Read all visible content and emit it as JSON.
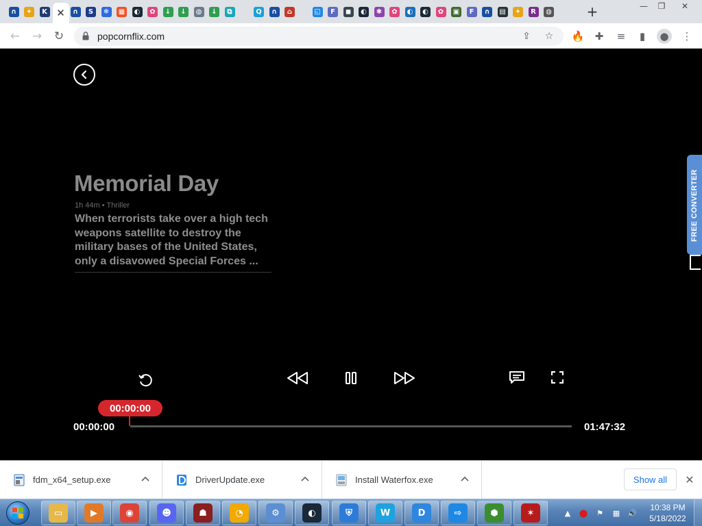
{
  "browser": {
    "tabs": [
      {
        "icon": "n-icon",
        "color": "#1a4fa0",
        "glyph": "∩"
      },
      {
        "icon": "fox-icon",
        "color": "#e8a317",
        "glyph": "✦"
      },
      {
        "icon": "k-icon",
        "color": "#1f3b73",
        "glyph": "K"
      },
      {
        "icon": "close-icon",
        "color": "#ffffff",
        "glyph": "✕",
        "active": true
      },
      {
        "icon": "n-icon",
        "color": "#1a4fa0",
        "glyph": "∩"
      },
      {
        "icon": "s-icon",
        "color": "#1e3a8a",
        "glyph": "S"
      },
      {
        "icon": "snowflake-icon",
        "color": "#2d6cdf",
        "glyph": "❄"
      },
      {
        "icon": "windows-icon",
        "color": "#f25022",
        "glyph": "▦"
      },
      {
        "icon": "steam-icon",
        "color": "#1b2838",
        "glyph": "◐"
      },
      {
        "icon": "pinwheel-icon",
        "color": "#e0457b",
        "glyph": "✿"
      },
      {
        "icon": "download-icon",
        "color": "#2e9e4f",
        "glyph": "↓"
      },
      {
        "icon": "download-icon",
        "color": "#2e9e4f",
        "glyph": "↓"
      },
      {
        "icon": "globe-icon",
        "color": "#6b7b8c",
        "glyph": "◍"
      },
      {
        "icon": "download-icon",
        "color": "#2e9e4f",
        "glyph": "↓"
      },
      {
        "icon": "copy-icon",
        "color": "#1aa6b7",
        "glyph": "⧉"
      },
      {
        "icon": "iq-icon",
        "color": "#1aa0d8",
        "glyph": "Q"
      },
      {
        "icon": "n-icon",
        "color": "#1a4fa0",
        "glyph": "∩"
      },
      {
        "icon": "house-icon",
        "color": "#c0392b",
        "glyph": "⌂"
      },
      {
        "icon": "frame-icon",
        "color": "#1e88e5",
        "glyph": "◱"
      },
      {
        "icon": "f-icon",
        "color": "#5c6bc0",
        "glyph": "F"
      },
      {
        "icon": "photo-icon",
        "color": "#37474f",
        "glyph": "◼"
      },
      {
        "icon": "steam-icon",
        "color": "#1b2838",
        "glyph": "◐"
      },
      {
        "icon": "puzzle-color-icon",
        "color": "#8e44ad",
        "glyph": "✱"
      },
      {
        "icon": "pinwheel-icon",
        "color": "#e0457b",
        "glyph": "✿"
      },
      {
        "icon": "steam-icon",
        "color": "#1b6fb8",
        "glyph": "◐"
      },
      {
        "icon": "steam-icon",
        "color": "#1b2838",
        "glyph": "◐"
      },
      {
        "icon": "pinwheel-icon",
        "color": "#e0457b",
        "glyph": "✿"
      },
      {
        "icon": "cube-icon",
        "color": "#3e6b2f",
        "glyph": "▣"
      },
      {
        "icon": "f-icon",
        "color": "#5c6bc0",
        "glyph": "F"
      },
      {
        "icon": "n-icon",
        "color": "#1a4fa0",
        "glyph": "∩"
      },
      {
        "icon": "film-icon",
        "color": "#263238",
        "glyph": "▤"
      },
      {
        "icon": "fox-icon",
        "color": "#e8a317",
        "glyph": "✦"
      },
      {
        "icon": "r-icon",
        "color": "#7b2d8e",
        "glyph": "R"
      },
      {
        "icon": "globe-icon",
        "color": "#555555",
        "glyph": "◍"
      }
    ],
    "new_tab_glyph": "+",
    "window_controls": {
      "minimize": "—",
      "restore": "❐",
      "close": "✕"
    },
    "nav": {
      "back": "←",
      "forward": "→",
      "reload": "↻"
    },
    "url": "popcornflix.com",
    "omnibox_icons": {
      "share": "⇪",
      "bookmark": "☆"
    },
    "toolbar_icons": {
      "flame": "🔥",
      "extensions": "✚",
      "reading_list": "≡",
      "side_panel": "▮",
      "profile": "●",
      "menu": "⋮"
    }
  },
  "player": {
    "title": "Memorial Day",
    "meta": "1h 44m • Thriller",
    "description": "When terrorists take over a high tech weapons satellite to destroy the military bases of the United States, only a disavowed Special Forces ...",
    "current_time_bubble": "00:00:00",
    "current_time": "00:00:00",
    "total_time": "01:47:32",
    "progress": 0.0,
    "controls": {
      "restart": "restart-icon",
      "rewind": "rewind-icon",
      "pause": "pause-icon",
      "fast_forward": "fast-forward-icon",
      "subtitles": "subtitles-icon",
      "fullscreen": "fullscreen-icon"
    },
    "accent_color": "#d6262d"
  },
  "extension_tab": {
    "label": "FREE CONVERTER"
  },
  "downloads": {
    "items": [
      {
        "name": "fdm_x64_setup.exe",
        "icon": "installer-icon"
      },
      {
        "name": "DriverUpdate.exe",
        "icon": "driverupdate-icon"
      },
      {
        "name": "Install Waterfox.exe",
        "icon": "waterfox-installer-icon"
      }
    ],
    "show_all_label": "Show all",
    "close_glyph": "✕"
  },
  "taskbar": {
    "apps": [
      {
        "name": "file-explorer-icon",
        "color": "#e6b84a",
        "glyph": "▭"
      },
      {
        "name": "media-player-icon",
        "color": "#e07a2a",
        "glyph": "▶"
      },
      {
        "name": "chrome-icon",
        "color": "#db4437",
        "glyph": "◉"
      },
      {
        "name": "discord-icon",
        "color": "#5865f2",
        "glyph": "☻"
      },
      {
        "name": "java-tool-icon",
        "color": "#8b1e1e",
        "glyph": "☗"
      },
      {
        "name": "vpn-icon",
        "color": "#f2a900",
        "glyph": "◔"
      },
      {
        "name": "network-tool-icon",
        "color": "#5b8fd1",
        "glyph": "⚙"
      },
      {
        "name": "steam-icon",
        "color": "#1b2838",
        "glyph": "◐"
      },
      {
        "name": "shield-app-icon",
        "color": "#2d7bd6",
        "glyph": "⛨"
      },
      {
        "name": "waterfox-icon",
        "color": "#1ea2e0",
        "glyph": "W"
      },
      {
        "name": "driverupdate-icon",
        "color": "#2e86de",
        "glyph": "D"
      },
      {
        "name": "remote-icon",
        "color": "#1e88e5",
        "glyph": "⇨"
      },
      {
        "name": "iobit-icon",
        "color": "#3c8d2f",
        "glyph": "⬢"
      },
      {
        "name": "antivirus-icon",
        "color": "#b71c1c",
        "glyph": "✶"
      }
    ],
    "tray": {
      "expand": "▲",
      "security": "⬤",
      "flag": "⚑",
      "network": "▦",
      "volume": "🔊"
    },
    "time": "10:38 PM",
    "date": "5/18/2022"
  }
}
